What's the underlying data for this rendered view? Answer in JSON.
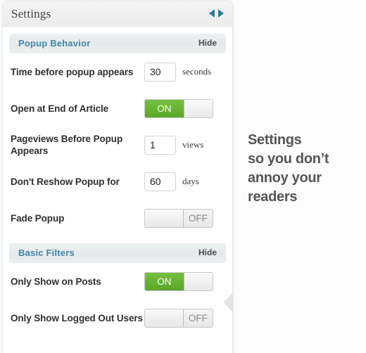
{
  "window": {
    "title": "Settings",
    "nav_prev_icon": "triangle-left-icon",
    "nav_next_icon": "triangle-right-icon",
    "accent_color": "#2a7ca0",
    "collapse_icon": "triangle-left-collapse-icon"
  },
  "sections": [
    {
      "id": "popup-behavior",
      "title": "Popup Behavior",
      "hide_label": "Hide",
      "rows": [
        {
          "id": "time-before-popup",
          "label": "Time before popup appears",
          "control": "number",
          "value": "30",
          "unit": "seconds"
        },
        {
          "id": "open-at-end-of-article",
          "label": "Open at End of Article",
          "control": "toggle",
          "state": "on",
          "state_label": "ON"
        },
        {
          "id": "pageviews-before-popup",
          "label": "Pageviews Before Popup Appears",
          "control": "number",
          "value": "1",
          "unit": "views"
        },
        {
          "id": "dont-reshow-popup",
          "label": "Don't Reshow Popup for",
          "control": "number",
          "value": "60",
          "unit": "days"
        },
        {
          "id": "fade-popup",
          "label": "Fade Popup",
          "control": "toggle",
          "state": "off",
          "state_label": "OFF"
        }
      ]
    },
    {
      "id": "basic-filters",
      "title": "Basic Filters",
      "hide_label": "Hide",
      "rows": [
        {
          "id": "only-show-on-posts",
          "label": "Only Show on Posts",
          "control": "toggle",
          "state": "on",
          "state_label": "ON"
        },
        {
          "id": "only-show-logged-out-users",
          "label": "Only Show Logged Out Users",
          "control": "toggle",
          "state": "off",
          "state_label": "OFF"
        }
      ]
    }
  ],
  "caption": {
    "line1": "Settings",
    "line2": "so you don’t",
    "line3": "annoy your",
    "line4": "readers"
  }
}
